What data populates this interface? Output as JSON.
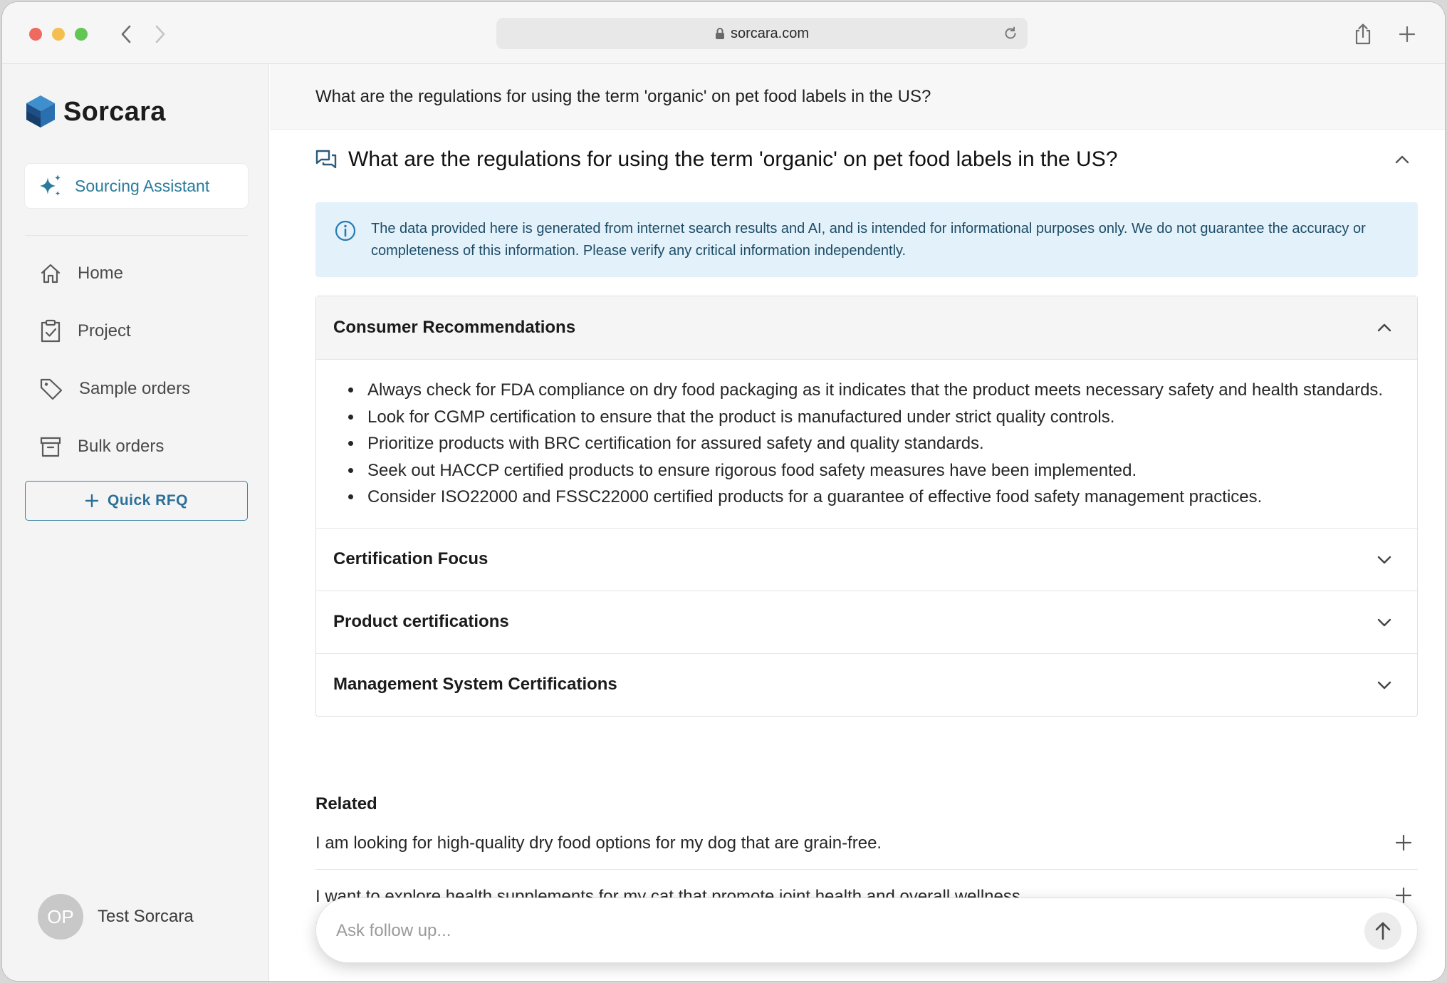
{
  "browser": {
    "url": "sorcara.com",
    "icons": [
      "back-icon",
      "forward-icon",
      "lock-icon",
      "reload-icon",
      "share-icon",
      "new-tab-icon"
    ]
  },
  "sidebar": {
    "brand_name": "Sorcara",
    "assistant_label": "Sourcing Assistant",
    "items": [
      {
        "label": "Home",
        "icon": "home-icon"
      },
      {
        "label": "Project",
        "icon": "clipboard-icon"
      },
      {
        "label": "Sample orders",
        "icon": "tag-icon"
      },
      {
        "label": "Bulk orders",
        "icon": "archive-icon"
      }
    ],
    "quick_rfq_label": "Quick RFQ",
    "user": {
      "initials": "OP",
      "name": "Test Sorcara"
    }
  },
  "main": {
    "query": "What are the regulations for using the term 'organic' on pet food labels in the US?",
    "answer_title": "What are the regulations for using the term 'organic' on pet food labels in the US?",
    "notice": "The data provided here is generated from internet search results and AI, and is intended for informational purposes only. We do not guarantee the accuracy or completeness of this information. Please verify any critical information independently.",
    "sections": [
      {
        "label": "Consumer Recommendations",
        "items": [
          "Always check for FDA compliance on dry food packaging as it indicates that the product meets necessary safety and health standards.",
          "Look for CGMP certification to ensure that the product is manufactured under strict quality controls.",
          "Prioritize products with BRC certification for assured safety and quality standards.",
          "Seek out HACCP certified products to ensure rigorous food safety measures have been implemented.",
          "Consider ISO22000 and FSSC22000 certified products for a guarantee of effective food safety management practices."
        ]
      },
      {
        "label": "Certification Focus"
      },
      {
        "label": "Product certifications"
      },
      {
        "label": "Management System Certifications"
      }
    ],
    "related_title": "Related",
    "related": [
      "I am looking for high-quality dry food options for my dog that are grain-free.",
      "I want to explore health supplements for my cat that promote joint health and overall wellness."
    ],
    "followup_placeholder": "Ask follow up..."
  },
  "colors": {
    "accent": "#2a7b9b",
    "notice_bg": "#e2f1fa",
    "sidebar_bg": "#f4f4f4"
  }
}
